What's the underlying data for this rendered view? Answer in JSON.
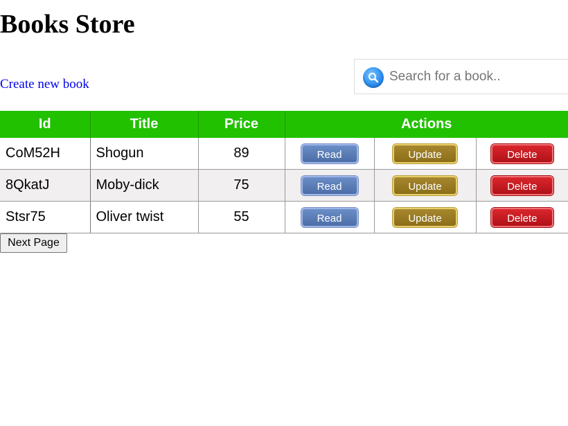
{
  "header": {
    "title": "Books Store",
    "create_link": "Create new book"
  },
  "search": {
    "placeholder": "Search for a book..",
    "value": "",
    "icon": "search-icon"
  },
  "table": {
    "columns": {
      "id": "Id",
      "title": "Title",
      "price": "Price",
      "actions": "Actions"
    },
    "rows": [
      {
        "id": "CoM52H",
        "title": "Shogun",
        "price": "89",
        "read": "Read",
        "update": "Update",
        "delete": "Delete"
      },
      {
        "id": "8QkatJ",
        "title": "Moby-dick",
        "price": "75",
        "read": "Read",
        "update": "Update",
        "delete": "Delete"
      },
      {
        "id": "Stsr75",
        "title": "Oliver twist",
        "price": "55",
        "read": "Read",
        "update": "Update",
        "delete": "Delete"
      }
    ]
  },
  "pagination": {
    "next_label": "Next Page"
  },
  "colors": {
    "header_bg": "#22c100",
    "link": "#0000ee",
    "read_button": "#5a7db7",
    "update_button": "#9a7b24",
    "delete_button": "#c51b21"
  }
}
